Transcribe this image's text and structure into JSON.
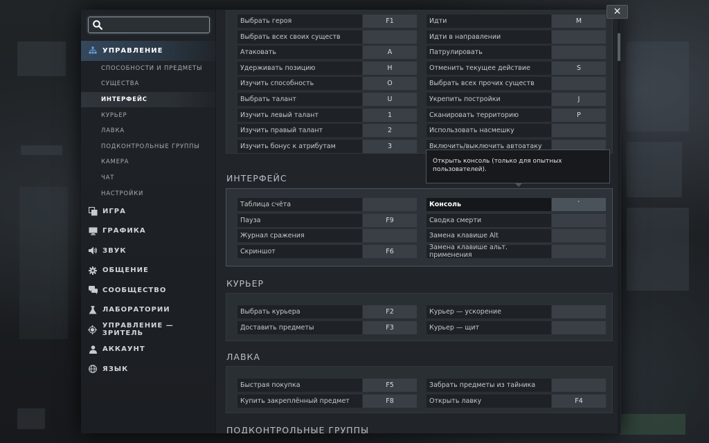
{
  "search": {
    "value": "",
    "placeholder": ""
  },
  "close_label": "✕",
  "nav": {
    "groups": [
      {
        "label": "УПРАВЛЕНИЕ",
        "icon": "hierarchy-icon",
        "active": true,
        "subs": [
          {
            "label": "СПОСОБНОСТИ И ПРЕДМЕТЫ"
          },
          {
            "label": "СУЩЕСТВА"
          },
          {
            "label": "ИНТЕРФЕЙС",
            "active": true
          },
          {
            "label": "КУРЬЕР"
          },
          {
            "label": "ЛАВКА"
          },
          {
            "label": "ПОДКОНТРОЛЬНЫЕ ГРУППЫ"
          },
          {
            "label": "КАМЕРА"
          },
          {
            "label": "ЧАТ"
          },
          {
            "label": "НАСТРОЙКИ"
          }
        ]
      },
      {
        "label": "ИГРА",
        "icon": "game-icon"
      },
      {
        "label": "ГРАФИКА",
        "icon": "monitor-icon"
      },
      {
        "label": "ЗВУК",
        "icon": "speaker-icon"
      },
      {
        "label": "ОБЩЕНИЕ",
        "icon": "gear-icon"
      },
      {
        "label": "СООБЩЕСТВО",
        "icon": "chat-icon"
      },
      {
        "label": "ЛАБОРАТОРИИ",
        "icon": "flask-icon"
      },
      {
        "label": "УПРАВЛЕНИЕ — ЗРИТЕЛЬ",
        "icon": "spectator-icon"
      },
      {
        "label": "АККАУНТ",
        "icon": "user-icon"
      },
      {
        "label": "ЯЗЫК",
        "icon": "globe-icon"
      }
    ]
  },
  "sections": {
    "top": {
      "left": [
        {
          "label": "Выбрать героя",
          "key": "F1"
        },
        {
          "label": "Выбрать всех своих существ",
          "key": ""
        },
        {
          "label": "Атаковать",
          "key": "A"
        },
        {
          "label": "Удерживать позицию",
          "key": "H"
        },
        {
          "label": "Изучить способность",
          "key": "O"
        },
        {
          "label": "Выбрать талант",
          "key": "U"
        },
        {
          "label": "Изучить левый талант",
          "key": "1"
        },
        {
          "label": "Изучить правый талант",
          "key": "2"
        },
        {
          "label": "Изучить бонус к атрибутам",
          "key": "3"
        }
      ],
      "right": [
        {
          "label": "Идти",
          "key": "M"
        },
        {
          "label": "Идти в направлении",
          "key": ""
        },
        {
          "label": "Патрулировать",
          "key": ""
        },
        {
          "label": "Отменить текущее действие",
          "key": "S"
        },
        {
          "label": "Выбрать всех прочих существ",
          "key": ""
        },
        {
          "label": "Укрепить постройки",
          "key": "J"
        },
        {
          "label": "Сканировать территорию",
          "key": "P"
        },
        {
          "label": "Использовать насмешку",
          "key": ""
        },
        {
          "label": "Включить/выключить автоатаку",
          "key": ""
        }
      ]
    },
    "interface": {
      "title": "ИНТЕРФЕЙС",
      "left": [
        {
          "label": "Таблица счёта",
          "key": ""
        },
        {
          "label": "Пауза",
          "key": "F9"
        },
        {
          "label": "Журнал сражения",
          "key": ""
        },
        {
          "label": "Скриншот",
          "key": "F6"
        }
      ],
      "right": [
        {
          "label": "Консоль",
          "key": "`"
        },
        {
          "label": "Сводка смерти",
          "key": ""
        },
        {
          "label": "Замена клавише Alt",
          "key": ""
        },
        {
          "label": "Замена клавише альт. применения",
          "key": ""
        }
      ]
    },
    "courier": {
      "title": "КУРЬЕР",
      "left": [
        {
          "label": "Выбрать курьера",
          "key": "F2"
        },
        {
          "label": "Доставить предметы",
          "key": "F3"
        }
      ],
      "right": [
        {
          "label": "Курьер — ускорение",
          "key": ""
        },
        {
          "label": "Курьер — щит",
          "key": ""
        }
      ]
    },
    "shop": {
      "title": "ЛАВКА",
      "left": [
        {
          "label": "Быстрая покупка",
          "key": "F5"
        },
        {
          "label": "Купить закреплённый предмет",
          "key": "F8"
        }
      ],
      "right": [
        {
          "label": "Забрать предметы из тайника",
          "key": ""
        },
        {
          "label": "Открыть лавку",
          "key": "F4"
        }
      ]
    },
    "groups": {
      "title": "ПОДКОНТРОЛЬНЫЕ ГРУППЫ"
    }
  },
  "tooltip": {
    "text": "Открыть консоль (только для опытных пользователей)."
  }
}
